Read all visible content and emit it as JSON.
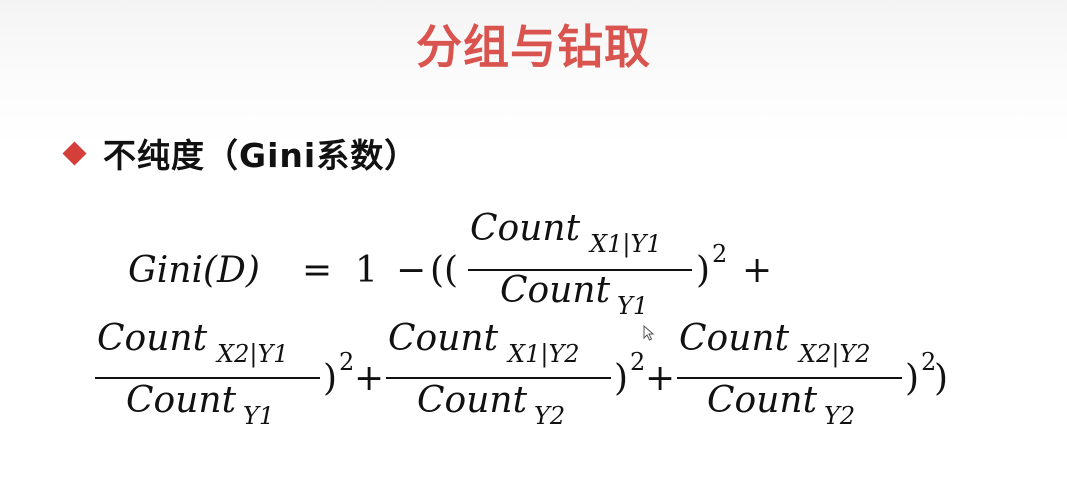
{
  "slide": {
    "title": "分组与钻取",
    "bullet": "不纯度（Gini系数）"
  },
  "colors": {
    "title": "#d9534f",
    "bullet_marker": "#d43f3a",
    "text": "#111111"
  },
  "icons": {
    "bullet_marker": "red-diamond",
    "cursor": "mouse-pointer"
  },
  "formula": {
    "lhs": "Gini(D)",
    "equals": "=",
    "one": "1",
    "minus": "−",
    "open_parens": "((",
    "plus": "+",
    "close_paren": ")",
    "close_all": "))",
    "square": "2",
    "count_word": "Count",
    "terms": [
      {
        "num_sub": "X1|Y1",
        "den_sub": "Y1"
      },
      {
        "num_sub": "X2|Y1",
        "den_sub": "Y1"
      },
      {
        "num_sub": "X1|Y2",
        "den_sub": "Y2"
      },
      {
        "num_sub": "X2|Y2",
        "den_sub": "Y2"
      }
    ]
  }
}
